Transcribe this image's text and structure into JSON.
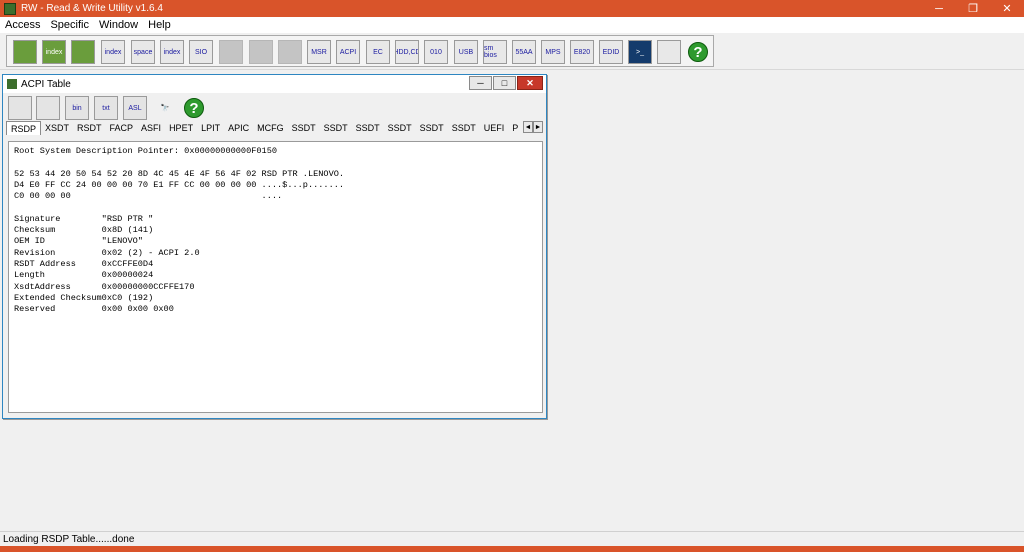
{
  "app": {
    "title": "RW - Read & Write Utility v1.6.4",
    "minimize": "─",
    "maximize": "❐",
    "close": "✕"
  },
  "menu": [
    "Access",
    "Specific",
    "Window",
    "Help"
  ],
  "toolbar": [
    {
      "name": "pci-icon",
      "label": ""
    },
    {
      "name": "pci-index-icon",
      "label": "index"
    },
    {
      "name": "memory-icon",
      "label": ""
    },
    {
      "name": "memory-index-icon",
      "label": "index"
    },
    {
      "name": "io-space-icon",
      "label": "space"
    },
    {
      "name": "io-index-icon",
      "label": "index"
    },
    {
      "name": "sio-icon",
      "label": "SIO"
    },
    {
      "name": "disabled-icon-1",
      "label": ""
    },
    {
      "name": "disabled-icon-2",
      "label": ""
    },
    {
      "name": "disabled-icon-3",
      "label": ""
    },
    {
      "name": "msr-icon",
      "label": "MSR"
    },
    {
      "name": "acpi-icon",
      "label": "ACPI"
    },
    {
      "name": "ec-icon",
      "label": "EC"
    },
    {
      "name": "hdd-icon",
      "label": "HDD,CD"
    },
    {
      "name": "cmos-icon",
      "label": "010"
    },
    {
      "name": "usb-icon",
      "label": "USB"
    },
    {
      "name": "smbios-icon",
      "label": "sm bios"
    },
    {
      "name": "55aa-icon",
      "label": "55AA"
    },
    {
      "name": "mps-icon",
      "label": "MPS"
    },
    {
      "name": "e820-icon",
      "label": "E820"
    },
    {
      "name": "edid-icon",
      "label": "EDID"
    },
    {
      "name": "command-icon",
      "label": ">_"
    },
    {
      "name": "scripts-icon",
      "label": ""
    },
    {
      "name": "help-icon",
      "label": "?"
    }
  ],
  "acpi_window": {
    "title": "ACPI Table",
    "minimize": "─",
    "maximize": "□",
    "close": "✕",
    "toolbar": [
      {
        "name": "save-icon",
        "label": ""
      },
      {
        "name": "save-all-icon",
        "label": ""
      },
      {
        "name": "save-bin-icon",
        "label": "bin"
      },
      {
        "name": "save-txt-icon",
        "label": "txt"
      },
      {
        "name": "asl-icon",
        "label": "ASL"
      },
      {
        "name": "find-icon",
        "label": "🔭"
      },
      {
        "name": "help-icon",
        "label": "?"
      }
    ],
    "tabs": [
      "RSDP",
      "XSDT",
      "RSDT",
      "FACP",
      "ASFI",
      "HPET",
      "LPIT",
      "APIC",
      "MCFG",
      "SSDT",
      "SSDT",
      "SSDT",
      "SSDT",
      "SSDT",
      "SSDT",
      "UEFI",
      "P"
    ],
    "active_tab": "RSDP",
    "tab_left": "◄",
    "tab_right": "►",
    "content_lines": [
      "Root System Description Pointer: 0x00000000000F0150",
      "",
      "52 53 44 20 50 54 52 20 8D 4C 45 4E 4F 56 4F 02 RSD PTR .LENOVO.",
      "D4 E0 FF CC 24 00 00 00 70 E1 FF CC 00 00 00 00 ....$...p.......",
      "C0 00 00 00                                     ....",
      "",
      "Signature        \"RSD PTR \"",
      "Checksum         0x8D (141)",
      "OEM ID           \"LENOVO\"",
      "Revision         0x02 (2) - ACPI 2.0",
      "RSDT Address     0xCCFFE0D4",
      "Length           0x00000024",
      "XsdtAddress      0x00000000CCFFE170",
      "Extended Checksum0xC0 (192)",
      "Reserved         0x00 0x00 0x00"
    ]
  },
  "status": "Loading RSDP Table......done"
}
